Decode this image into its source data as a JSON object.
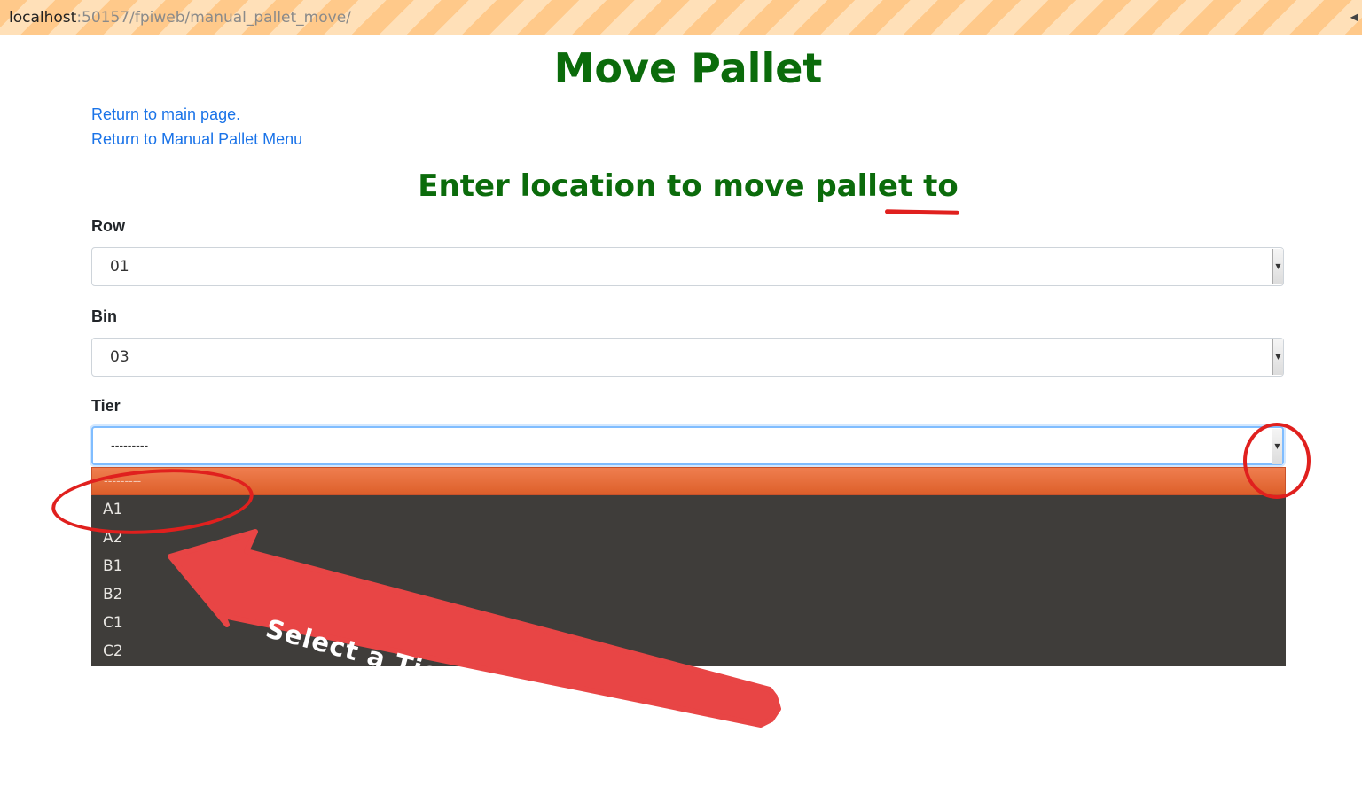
{
  "browser": {
    "url_host": "localhost",
    "url_path": ":50157/fpiweb/manual_pallet_move/"
  },
  "page": {
    "title": "Move Pallet",
    "links": {
      "main": "Return to main page.",
      "menu": "Return to Manual Pallet Menu"
    },
    "subtitle": "Enter location to move pallet to"
  },
  "form": {
    "row": {
      "label": "Row",
      "value": "01"
    },
    "bin": {
      "label": "Bin",
      "value": "03"
    },
    "tier": {
      "label": "Tier",
      "value": "---------",
      "options": [
        "---------",
        "A1",
        "A2",
        "B1",
        "B2",
        "C1",
        "C2"
      ]
    }
  },
  "annotation": {
    "callout": "Select a Tier from the dropdown list",
    "color": "#e84545"
  },
  "colors": {
    "heading": "#0b6b0b",
    "link": "#1a73e8",
    "dropdown_bg": "#3f3d3a",
    "dropdown_selected": "#e8703e"
  }
}
